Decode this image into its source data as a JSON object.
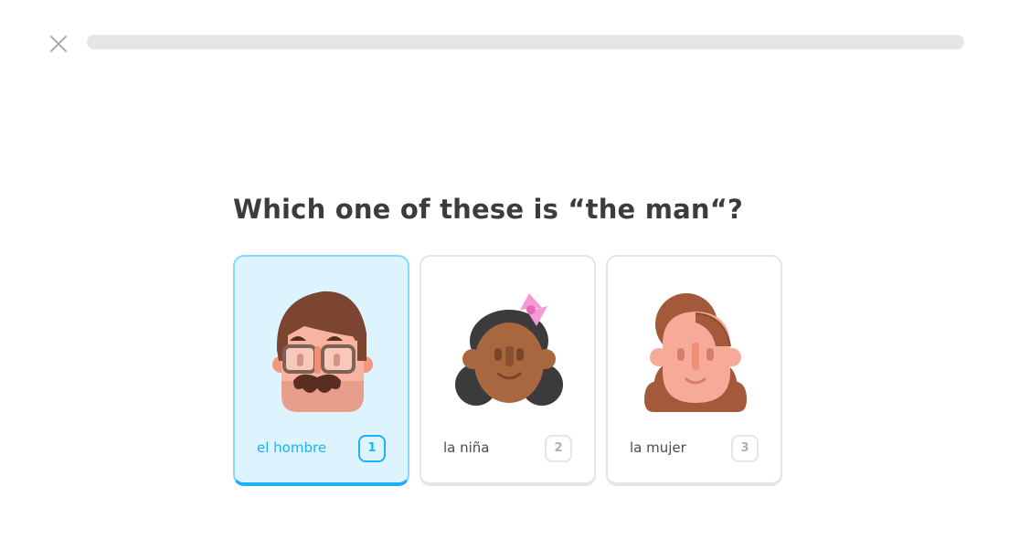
{
  "header": {
    "close_icon": "close-icon",
    "progress_percent": 0
  },
  "challenge": {
    "prompt": "Which one of these is “the man“?"
  },
  "choices": [
    {
      "label": "el hombre",
      "key": "1",
      "illustration": "man-with-glasses-icon",
      "selected": true
    },
    {
      "label": "la niña",
      "key": "2",
      "illustration": "girl-with-bow-icon",
      "selected": false
    },
    {
      "label": "la mujer",
      "key": "3",
      "illustration": "woman-icon",
      "selected": false
    }
  ],
  "colors": {
    "selected_border": "#1cb0f6",
    "selected_background": "#ddf4ff",
    "card_border": "#e5e5e5",
    "text": "#3c3c3c"
  }
}
